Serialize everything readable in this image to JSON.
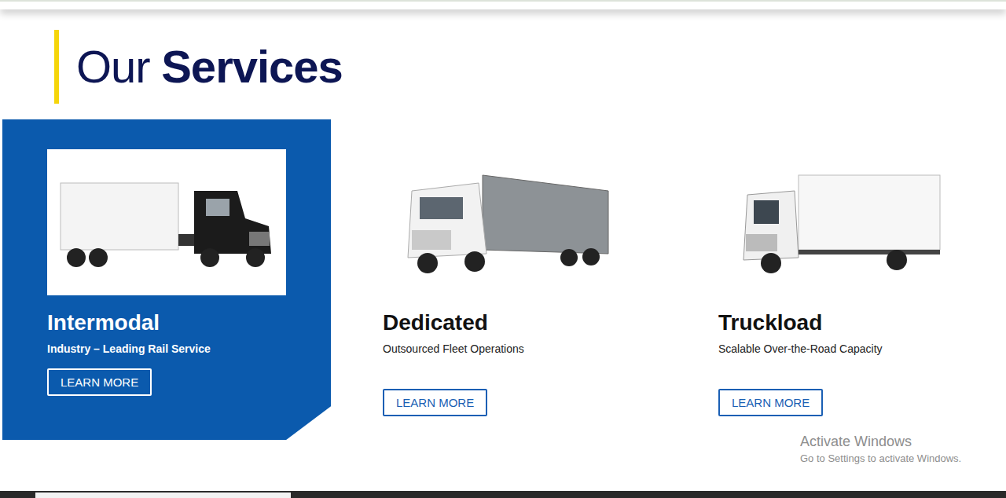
{
  "heading": {
    "light": "Our",
    "bold": "Services"
  },
  "services": [
    {
      "title": "Intermodal",
      "subtitle": "Industry – Leading Rail Service",
      "button": "LEARN MORE",
      "selected": true
    },
    {
      "title": "Dedicated",
      "subtitle": "Outsourced Fleet Operations",
      "button": "LEARN MORE",
      "selected": false
    },
    {
      "title": "Truckload",
      "subtitle": "Scalable Over-the-Road Capacity",
      "button": "LEARN MORE",
      "selected": false
    }
  ],
  "watermark": {
    "title": "Activate Windows",
    "subtitle": "Go to Settings to activate Windows."
  }
}
